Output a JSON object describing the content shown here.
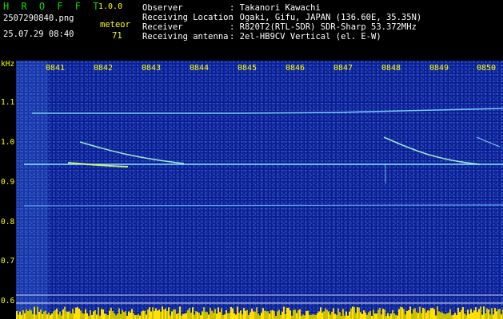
{
  "header": {
    "app_title": "H R O F F T",
    "version": "1.0.0",
    "filename": "2507290840.png",
    "datetime": "25.07.29 08:40",
    "meteor_label": "meteor",
    "meteor_count": "71"
  },
  "info": [
    {
      "key": "Observer",
      "value": ": Takanori Kawachi"
    },
    {
      "key": "Receiving Location",
      "value": ": Ogaki, Gifu, JAPAN (136.60E, 35.35N)"
    },
    {
      "key": "Receiver",
      "value": ": R820T2(RTL-SDR) SDR-Sharp 53.372MHz"
    },
    {
      "key": "Receiving antenna",
      "value": ": 2el-HB9CV Vertical (el. E-W)"
    }
  ],
  "axis": {
    "unit": "kHz",
    "y_ticks": [
      "1.1",
      "1.0",
      "0.9",
      "0.8",
      "0.7",
      "0.6"
    ],
    "x_ticks": [
      "0841",
      "0842",
      "0843",
      "0844",
      "0845",
      "0846",
      "0847",
      "0848",
      "0849",
      "0850"
    ]
  },
  "colors": {
    "background": "#071a8a",
    "header_green": "#00e000",
    "label_yellow": "#ffff00",
    "trace": "#7fe0ff"
  }
}
